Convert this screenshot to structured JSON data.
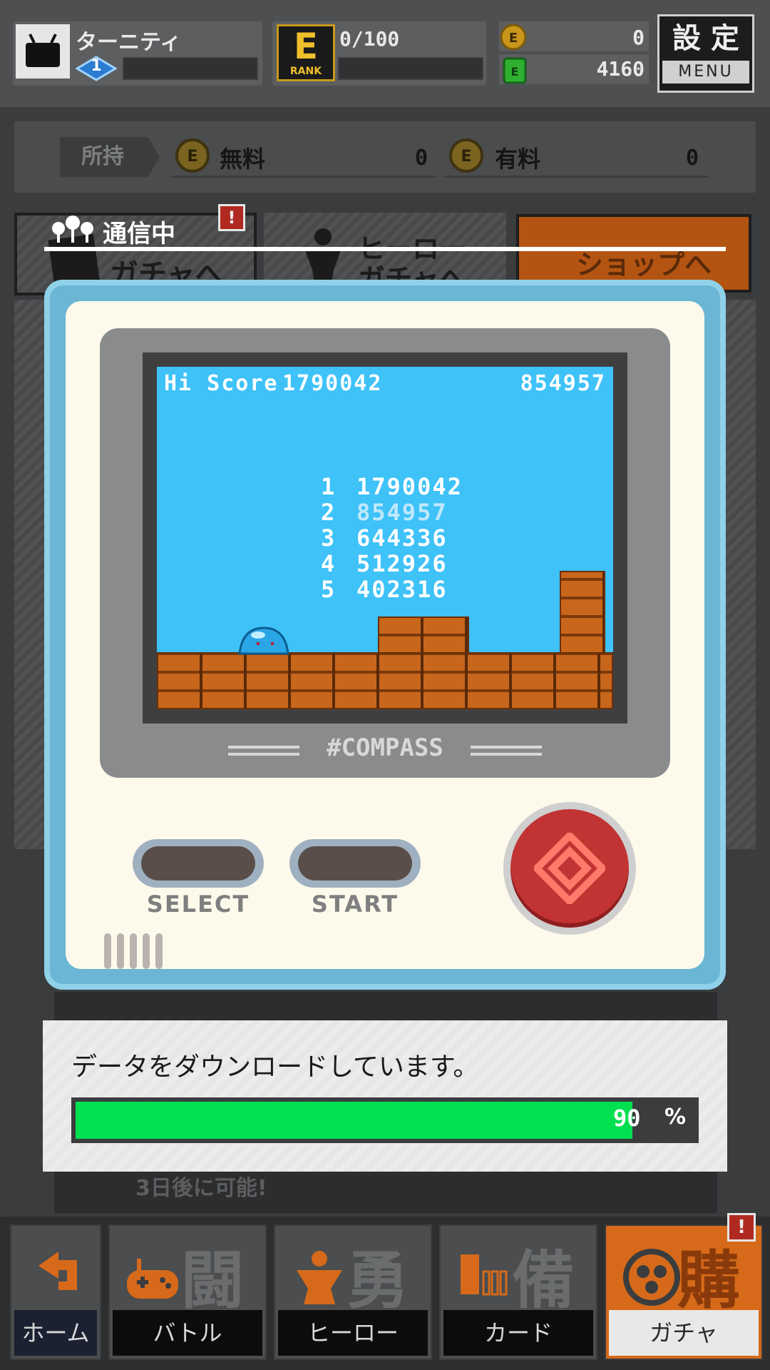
{
  "header": {
    "player_name": "ターニティ",
    "player_level": "1",
    "rank_letter": "E",
    "rank_caption": "RANK",
    "rank_progress": "0/100",
    "rank_fill": 0.0,
    "coin_gold": "0",
    "coin_green": "4160",
    "settings_label": "設 定",
    "menu_label": "MENU"
  },
  "holdings": {
    "label": "所持",
    "free_label": "無料",
    "free_value": "0",
    "paid_label": "有料",
    "paid_value": "0"
  },
  "shortcuts": {
    "card_gacha": "ガチャへ",
    "hero_gacha_line1": "ヒーロー",
    "hero_gacha_line2": "ガチャへ",
    "shop": "ショップへ"
  },
  "connecting_label": "通信中",
  "minigame": {
    "hi_score_label": "Hi Score",
    "hi_score": "1790042",
    "current_score": "854957",
    "rankings": [
      {
        "rank": "1",
        "score": "1790042"
      },
      {
        "rank": "2",
        "score": "854957"
      },
      {
        "rank": "3",
        "score": "644336"
      },
      {
        "rank": "4",
        "score": "512926"
      },
      {
        "rank": "5",
        "score": "402316"
      }
    ],
    "brand": "#COMPASS",
    "select_label": "SELECT",
    "start_label": "START"
  },
  "behind": {
    "cooldown_text": "3日後に可能!"
  },
  "loading": {
    "message": "データをダウンロードしています。",
    "percent_value": "90",
    "percent_sign": "%",
    "progress": 0.9
  },
  "bottom_nav": [
    {
      "big": "",
      "label": "ホーム"
    },
    {
      "big": "闘",
      "label": "バトル"
    },
    {
      "big": "勇",
      "label": "ヒーロー"
    },
    {
      "big": "備",
      "label": "カード"
    },
    {
      "big": "購",
      "label": "ガチャ"
    }
  ],
  "colors": {
    "accent_orange": "#d66a1a",
    "progress_green": "#00e050",
    "screen_blue": "#3ec2f8",
    "device_blue": "#6ab6d4"
  }
}
